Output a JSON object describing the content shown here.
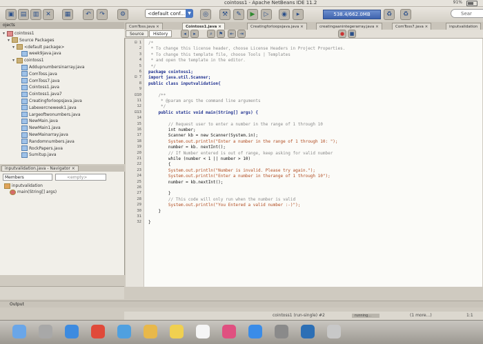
{
  "menubar": {
    "window_title": "cointoss1 - Apache NetBeans IDE 11.2",
    "battery": "91%"
  },
  "toolbar": {
    "config": "<default conf...",
    "memory": "538.4/662.0MB",
    "search_placeholder": "Sear"
  },
  "projects": {
    "tab_label": "ojects",
    "rows": [
      {
        "indent": 0,
        "icon": "proj",
        "tw": "▾",
        "label": "cointoss1"
      },
      {
        "indent": 1,
        "icon": "pkg",
        "tw": "▾",
        "label": "Source Packages"
      },
      {
        "indent": 2,
        "icon": "pkg",
        "tw": "▾",
        "label": "<default package>"
      },
      {
        "indent": 3,
        "icon": "java",
        "tw": "",
        "label": "week9java.java"
      },
      {
        "indent": 2,
        "icon": "pkg",
        "tw": "▾",
        "label": "cointoss1"
      },
      {
        "indent": 3,
        "icon": "java",
        "tw": "",
        "label": "Addupnumbersinarray.java"
      },
      {
        "indent": 3,
        "icon": "java",
        "tw": "",
        "label": "ComToss.java"
      },
      {
        "indent": 3,
        "icon": "java",
        "tw": "",
        "label": "ComToss7.java"
      },
      {
        "indent": 3,
        "icon": "java",
        "tw": "",
        "label": "Cointoss1.java"
      },
      {
        "indent": 3,
        "icon": "java",
        "tw": "",
        "label": "Cointoss1.java7"
      },
      {
        "indent": 3,
        "icon": "java",
        "tw": "",
        "label": "Creatingforloopsjava.java"
      },
      {
        "indent": 3,
        "icon": "java",
        "tw": "",
        "label": "Labexercneweek1.java"
      },
      {
        "indent": 3,
        "icon": "java",
        "tw": "",
        "label": "Largeoftwonumbers.java"
      },
      {
        "indent": 3,
        "icon": "java",
        "tw": "",
        "label": "NewMain.java"
      },
      {
        "indent": 3,
        "icon": "java",
        "tw": "",
        "label": "NewMain1.java"
      },
      {
        "indent": 3,
        "icon": "java",
        "tw": "",
        "label": "NewMainarray.java"
      },
      {
        "indent": 3,
        "icon": "java",
        "tw": "",
        "label": "Randomnumbers.java"
      },
      {
        "indent": 3,
        "icon": "java",
        "tw": "",
        "label": "RockPapers.java"
      },
      {
        "indent": 3,
        "icon": "java",
        "tw": "",
        "label": "Sumitup.java"
      }
    ]
  },
  "navigator": {
    "tab_label": "inputvalidation.java - Navigator ×",
    "members_label": "Members",
    "empty_label": "<empty>",
    "rows": [
      {
        "indent": 0,
        "label": "inputvalidation"
      },
      {
        "indent": 1,
        "label": "main(String[] args)"
      }
    ]
  },
  "editor": {
    "tabs": [
      {
        "label": "ComToss.java ×",
        "active": false
      },
      {
        "label": "Cointoss1.java ×",
        "active": true
      },
      {
        "label": "Creatingforloopsjava.java ×",
        "active": false
      },
      {
        "label": "creatingaanintegerarray.java ×",
        "active": false
      },
      {
        "label": "ComToss7.java ×",
        "active": false
      },
      {
        "label": "inputvalidation",
        "active": false
      }
    ],
    "source_label": "Source",
    "history_label": "History",
    "line_numbers": [
      "1",
      "2",
      "3",
      "4",
      "5",
      "6",
      "7",
      "8",
      "9",
      "10",
      "11",
      "12",
      "13",
      "14",
      "15",
      "16",
      "17",
      "18",
      "19",
      "20",
      "21",
      "22",
      "23",
      "24",
      "25",
      "26",
      "27",
      "28",
      "29",
      "30",
      "31",
      "32"
    ],
    "lines": [
      {
        "cls": "cm",
        "text": "/*"
      },
      {
        "cls": "cm",
        "text": " * To change this license header, choose License Headers in Project Properties."
      },
      {
        "cls": "cm",
        "text": " * To change this template file, choose Tools | Templates"
      },
      {
        "cls": "cm",
        "text": " * and open the template in the editor."
      },
      {
        "cls": "cm",
        "text": " */"
      },
      {
        "cls": "kw",
        "text": "package cointoss1;"
      },
      {
        "cls": "kw",
        "text": "import java.util.Scanner;"
      },
      {
        "cls": "kw",
        "text": "public class inputvalidation{"
      },
      {
        "cls": "tx",
        "text": ""
      },
      {
        "cls": "cm",
        "text": "    /**"
      },
      {
        "cls": "cm",
        "text": "     * @param args the command line arguments"
      },
      {
        "cls": "cm",
        "text": "     */"
      },
      {
        "cls": "kw",
        "text": "    public static void main(String[] args) {"
      },
      {
        "cls": "tx",
        "text": ""
      },
      {
        "cls": "cm",
        "text": "        // Request user to enter a number in the range of 1 through 10"
      },
      {
        "cls": "tx",
        "text": "        int number;"
      },
      {
        "cls": "tx",
        "text": "        Scanner kb = new Scanner(System.in);"
      },
      {
        "cls": "st",
        "text": "        System.out.println(\"Enter a number in the range of 1 through 10: \");"
      },
      {
        "cls": "tx",
        "text": "        number = kb. nextInt();"
      },
      {
        "cls": "cm",
        "text": "        // If Number entered is out of range, keep asking for valid number"
      },
      {
        "cls": "tx",
        "text": "        while (number < 1 || number > 10)"
      },
      {
        "cls": "tx",
        "text": "        {"
      },
      {
        "cls": "st",
        "text": "        System.out.println(\"Number is invalid. Please try again.\");"
      },
      {
        "cls": "st",
        "text": "        System.out.println(\"Enter a number in therange of 1 through 10\");"
      },
      {
        "cls": "tx",
        "text": "        number = kb.nextInt();"
      },
      {
        "cls": "tx",
        "text": ""
      },
      {
        "cls": "tx",
        "text": "        }"
      },
      {
        "cls": "cm",
        "text": "        // This code will only run when the number is valid"
      },
      {
        "cls": "st",
        "text": "        System.out.println(\"You Entered a valid number :-)\");"
      },
      {
        "cls": "tx",
        "text": "    }"
      },
      {
        "cls": "tx",
        "text": ""
      },
      {
        "cls": "tx",
        "text": "}"
      }
    ]
  },
  "output": {
    "tab_label": "Output"
  },
  "status": {
    "run_label": "cointoss1 (run-single) #2",
    "running": "running...",
    "more": "(1 more...)",
    "position": "1:1"
  },
  "colors": {
    "accent": "#4a78c4",
    "memory_bar": "#3e63ad"
  },
  "dock_icons": [
    "finder-icon",
    "launchpad-icon",
    "safari-icon",
    "chrome-icon",
    "mail-icon",
    "photos-icon",
    "notes-icon",
    "calendar-icon",
    "music-icon",
    "appstore-icon",
    "settings-icon",
    "netbeans-icon",
    "trash-icon"
  ]
}
